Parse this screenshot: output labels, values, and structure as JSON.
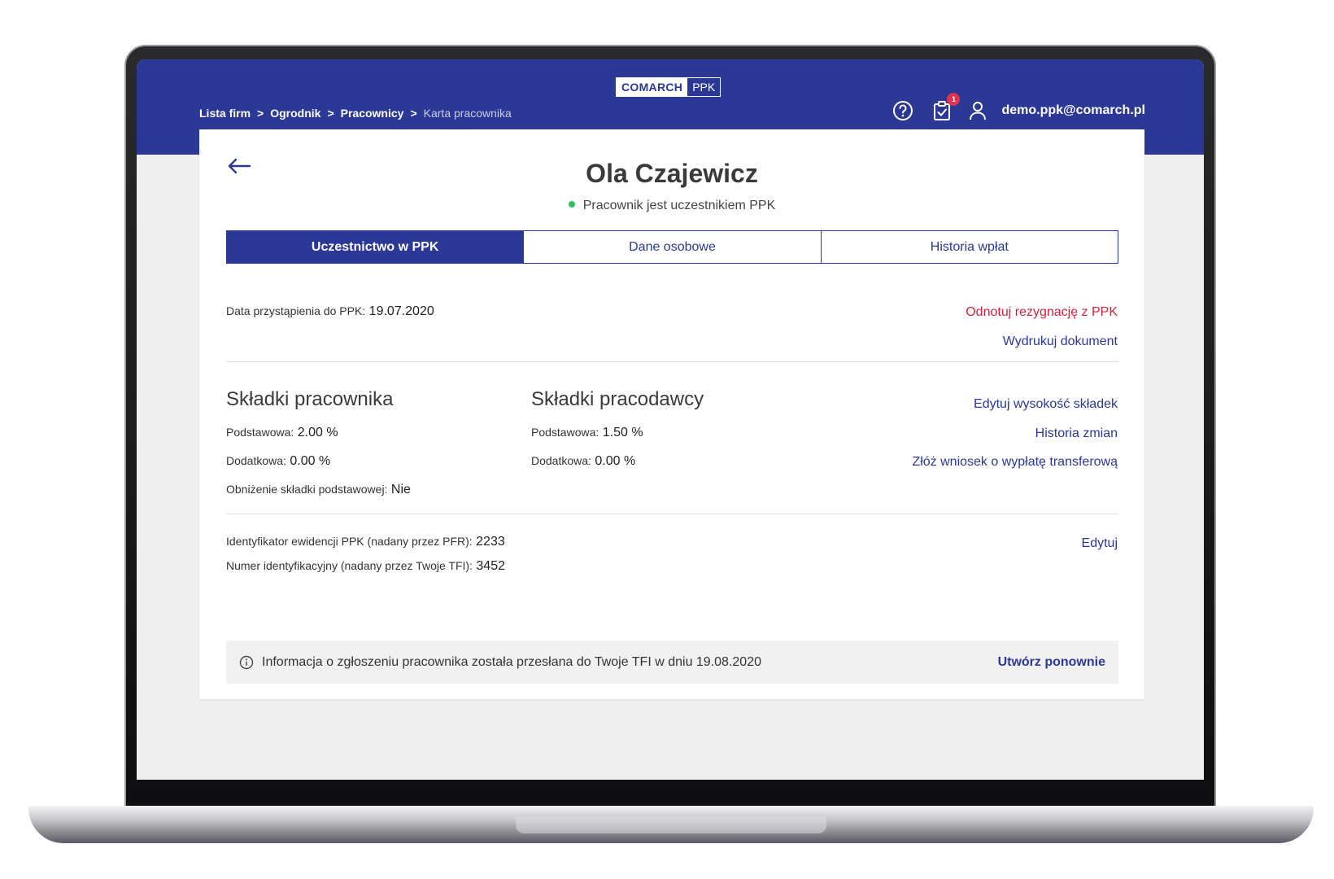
{
  "header": {
    "logo_brand": "COMARCH",
    "logo_product": "PPK",
    "breadcrumb": [
      "Lista firm",
      "Ogrodnik",
      "Pracownicy",
      "Karta pracownika"
    ],
    "breadcrumb_separator": ">",
    "notification_count": "1",
    "user_email": "demo.ppk@comarch.pl"
  },
  "employee": {
    "name": "Ola Czajewicz",
    "status": "Pracownik jest uczestnikiem PPK",
    "status_color": "#2dbe60"
  },
  "tabs": [
    {
      "label": "Uczestnictwo w PPK",
      "active": true
    },
    {
      "label": "Dane osobowe",
      "active": false
    },
    {
      "label": "Historia wpłat",
      "active": false
    }
  ],
  "participation": {
    "join_date_label": "Data przystąpienia do PPK:",
    "join_date_value": "19.07.2020",
    "action_resign": "Odnotuj rezygnację z PPK",
    "action_print": "Wydrukuj dokument"
  },
  "employee_contributions": {
    "title": "Składki pracownika",
    "basic_label": "Podstawowa:",
    "basic_value": "2.00 %",
    "additional_label": "Dodatkowa:",
    "additional_value": "0.00 %",
    "reduction_label": "Obniżenie składki podstawowej:",
    "reduction_value": "Nie"
  },
  "employer_contributions": {
    "title": "Składki pracodawcy",
    "basic_label": "Podstawowa:",
    "basic_value": "1.50 %",
    "additional_label": "Dodatkowa:",
    "additional_value": "0.00 %"
  },
  "contribution_actions": {
    "edit": "Edytuj wysokość składek",
    "history": "Historia zmian",
    "transfer": "Złóż wniosek o wypłatę transferową"
  },
  "identifiers": {
    "pfr_label": "Identyfikator ewidencji PPK (nadany przez PFR):",
    "pfr_value": "2233",
    "tfi_label": "Numer identyfikacyjny (nadany przez Twoje TFI):",
    "tfi_value": "3452",
    "edit": "Edytuj"
  },
  "info": {
    "text": "Informacja o zgłoszeniu pracownika została przesłana do Twoje TFI w dniu 19.08.2020",
    "action": "Utwórz ponownie"
  },
  "colors": {
    "brand": "#2c3896",
    "danger": "#d4213f",
    "background": "#efefef"
  }
}
